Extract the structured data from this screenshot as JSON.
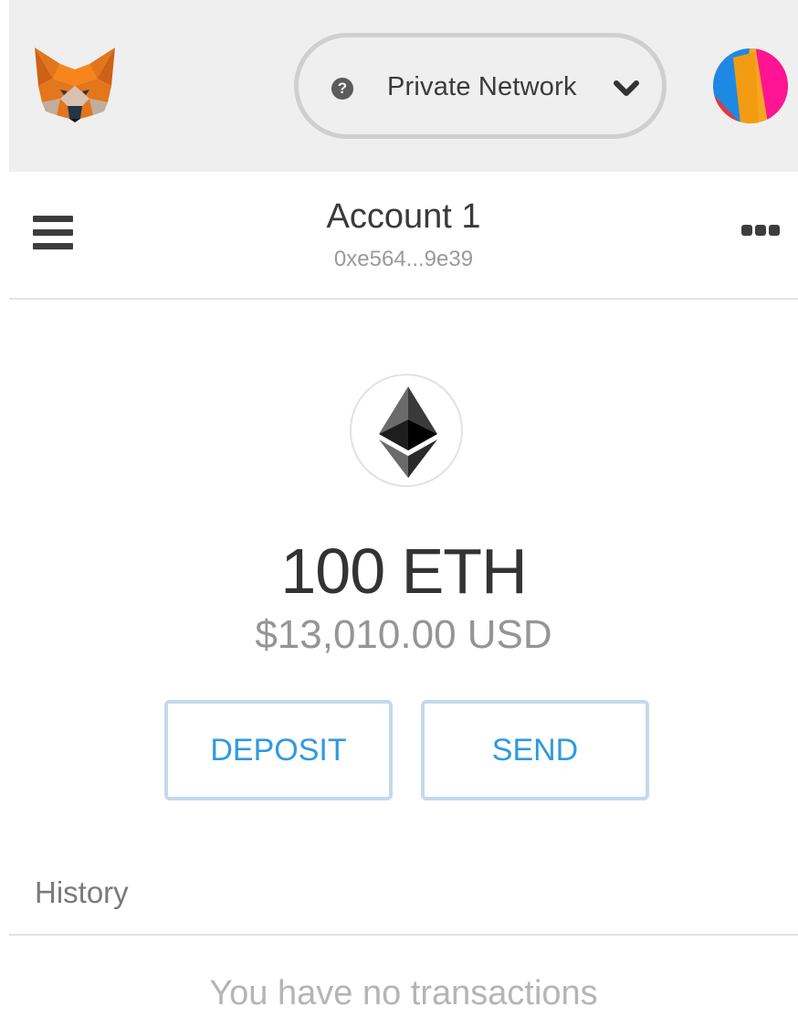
{
  "header": {
    "logo_icon": "metamask-fox-icon",
    "network": {
      "status_icon": "question-circle-icon",
      "label": "Private Network",
      "dropdown_icon": "chevron-down-icon"
    },
    "avatar_icon": "account-identicon"
  },
  "account": {
    "menu_icon": "hamburger-menu-icon",
    "name": "Account 1",
    "address": "0xe564...9e39",
    "options_icon": "more-dots-icon"
  },
  "balance": {
    "token_icon": "ethereum-icon",
    "eth": "100 ETH",
    "usd": "$13,010.00 USD"
  },
  "actions": {
    "deposit_label": "DEPOSIT",
    "send_label": "SEND"
  },
  "history": {
    "title": "History",
    "empty_text": "You have no transactions"
  },
  "colors": {
    "header_bg": "#efefef",
    "button_text": "#2f9ae0",
    "button_border": "#c3d9ec"
  }
}
